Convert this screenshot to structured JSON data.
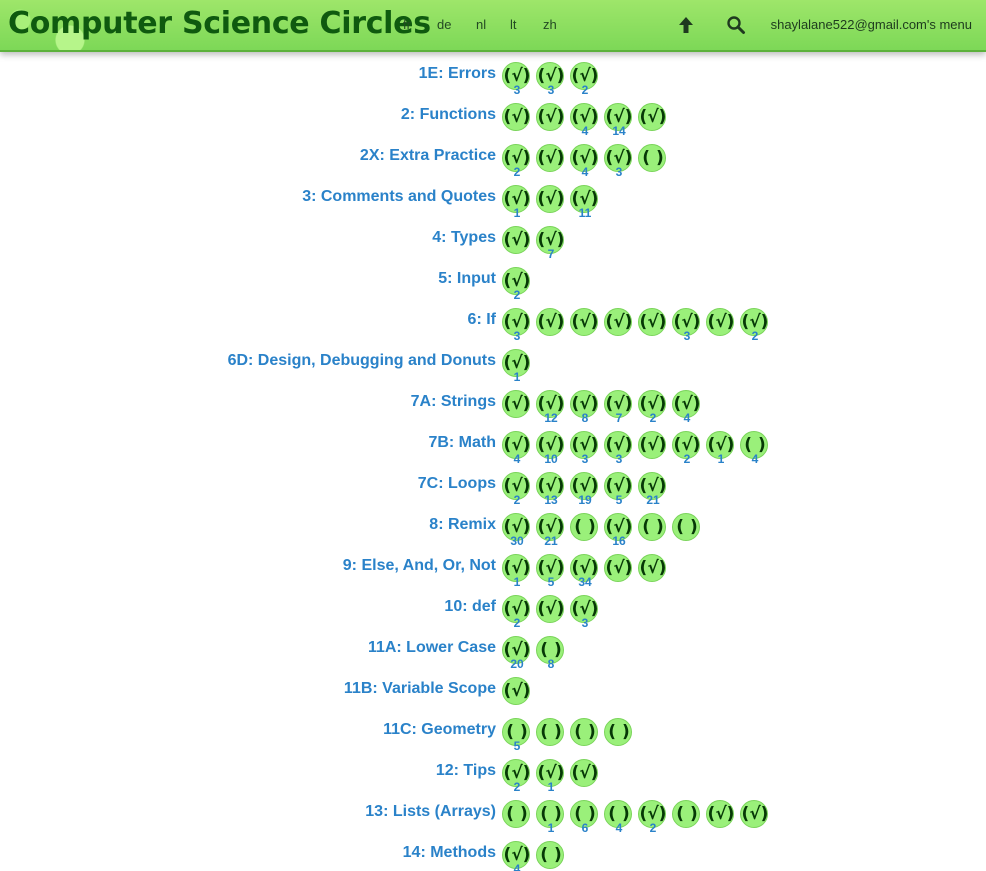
{
  "header": {
    "title": "Computer Science Circles",
    "languages": [
      "fr",
      "de",
      "nl",
      "lt",
      "zh"
    ],
    "up_icon": "arrow-up-icon",
    "search_icon": "search-icon",
    "user_menu": "shaylalane522@gmail.com's menu"
  },
  "marks": {
    "done": "(√)",
    "todo": "( )"
  },
  "lessons": [
    {
      "title": "1E: Errors",
      "ex": [
        {
          "s": "done",
          "n": "3"
        },
        {
          "s": "done",
          "n": "3"
        },
        {
          "s": "done",
          "n": "2"
        }
      ]
    },
    {
      "title": "2: Functions",
      "ex": [
        {
          "s": "done",
          "n": ""
        },
        {
          "s": "done",
          "n": ""
        },
        {
          "s": "done",
          "n": "4"
        },
        {
          "s": "done",
          "n": "14"
        },
        {
          "s": "done",
          "n": ""
        }
      ]
    },
    {
      "title": "2X: Extra Practice",
      "ex": [
        {
          "s": "done",
          "n": "2"
        },
        {
          "s": "done",
          "n": ""
        },
        {
          "s": "done",
          "n": "4"
        },
        {
          "s": "done",
          "n": "3"
        },
        {
          "s": "todo",
          "n": ""
        }
      ]
    },
    {
      "title": "3: Comments and Quotes",
      "ex": [
        {
          "s": "done",
          "n": "1"
        },
        {
          "s": "done",
          "n": ""
        },
        {
          "s": "done",
          "n": "11"
        }
      ]
    },
    {
      "title": "4: Types",
      "ex": [
        {
          "s": "done",
          "n": ""
        },
        {
          "s": "done",
          "n": "7"
        }
      ]
    },
    {
      "title": "5: Input",
      "ex": [
        {
          "s": "done",
          "n": "2"
        }
      ]
    },
    {
      "title": "6: If",
      "ex": [
        {
          "s": "done",
          "n": "3"
        },
        {
          "s": "done",
          "n": ""
        },
        {
          "s": "done",
          "n": ""
        },
        {
          "s": "done",
          "n": ""
        },
        {
          "s": "done",
          "n": ""
        },
        {
          "s": "done",
          "n": "3"
        },
        {
          "s": "done",
          "n": ""
        },
        {
          "s": "done",
          "n": "2"
        }
      ]
    },
    {
      "title": "6D: Design, Debugging and Donuts",
      "ex": [
        {
          "s": "done",
          "n": "1"
        }
      ]
    },
    {
      "title": "7A: Strings",
      "ex": [
        {
          "s": "done",
          "n": ""
        },
        {
          "s": "done",
          "n": "12"
        },
        {
          "s": "done",
          "n": "8"
        },
        {
          "s": "done",
          "n": "7"
        },
        {
          "s": "done",
          "n": "2"
        },
        {
          "s": "done",
          "n": "4"
        }
      ]
    },
    {
      "title": "7B: Math",
      "ex": [
        {
          "s": "done",
          "n": "4"
        },
        {
          "s": "done",
          "n": "10"
        },
        {
          "s": "done",
          "n": "3"
        },
        {
          "s": "done",
          "n": "3"
        },
        {
          "s": "done",
          "n": ""
        },
        {
          "s": "done",
          "n": "2"
        },
        {
          "s": "done",
          "n": "1"
        },
        {
          "s": "todo",
          "n": "4"
        }
      ]
    },
    {
      "title": "7C: Loops",
      "ex": [
        {
          "s": "done",
          "n": "2"
        },
        {
          "s": "done",
          "n": "13"
        },
        {
          "s": "done",
          "n": "19"
        },
        {
          "s": "done",
          "n": "5"
        },
        {
          "s": "done",
          "n": "21"
        }
      ]
    },
    {
      "title": "8: Remix",
      "ex": [
        {
          "s": "done",
          "n": "30"
        },
        {
          "s": "done",
          "n": "21"
        },
        {
          "s": "todo",
          "n": ""
        },
        {
          "s": "done",
          "n": "16"
        },
        {
          "s": "todo",
          "n": ""
        },
        {
          "s": "todo",
          "n": ""
        }
      ]
    },
    {
      "title": "9: Else, And, Or, Not",
      "ex": [
        {
          "s": "done",
          "n": "1"
        },
        {
          "s": "done",
          "n": "5"
        },
        {
          "s": "done",
          "n": "34"
        },
        {
          "s": "done",
          "n": ""
        },
        {
          "s": "done",
          "n": ""
        }
      ]
    },
    {
      "title": "10: def",
      "ex": [
        {
          "s": "done",
          "n": "2"
        },
        {
          "s": "done",
          "n": ""
        },
        {
          "s": "done",
          "n": "3"
        }
      ]
    },
    {
      "title": "11A: Lower Case",
      "ex": [
        {
          "s": "done",
          "n": "20"
        },
        {
          "s": "todo",
          "n": "8"
        }
      ]
    },
    {
      "title": "11B: Variable Scope",
      "ex": [
        {
          "s": "done",
          "n": ""
        }
      ]
    },
    {
      "title": "11C: Geometry",
      "ex": [
        {
          "s": "todo",
          "n": "5"
        },
        {
          "s": "todo",
          "n": ""
        },
        {
          "s": "todo",
          "n": ""
        },
        {
          "s": "todo",
          "n": ""
        }
      ]
    },
    {
      "title": "12: Tips",
      "ex": [
        {
          "s": "done",
          "n": "2"
        },
        {
          "s": "done",
          "n": "1"
        },
        {
          "s": "done",
          "n": ""
        }
      ]
    },
    {
      "title": "13: Lists (Arrays)",
      "ex": [
        {
          "s": "todo",
          "n": ""
        },
        {
          "s": "todo",
          "n": "1"
        },
        {
          "s": "todo",
          "n": "6"
        },
        {
          "s": "todo",
          "n": "4"
        },
        {
          "s": "done",
          "n": "2"
        },
        {
          "s": "todo",
          "n": ""
        },
        {
          "s": "done",
          "n": ""
        },
        {
          "s": "done",
          "n": ""
        }
      ]
    },
    {
      "title": "14: Methods",
      "ex": [
        {
          "s": "done",
          "n": "4"
        },
        {
          "s": "todo",
          "n": ""
        }
      ]
    }
  ]
}
